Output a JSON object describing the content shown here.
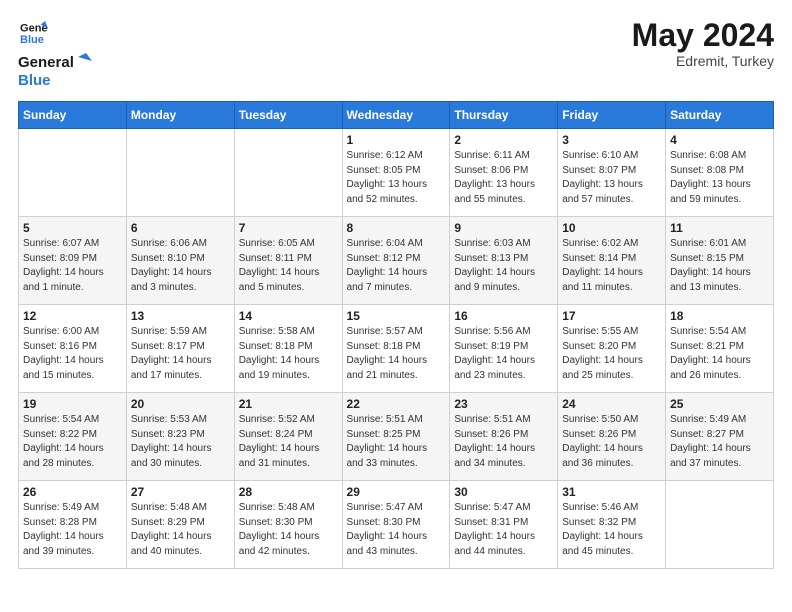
{
  "logo": {
    "line1": "General",
    "line2": "Blue"
  },
  "title": "May 2024",
  "subtitle": "Edremit, Turkey",
  "header_days": [
    "Sunday",
    "Monday",
    "Tuesday",
    "Wednesday",
    "Thursday",
    "Friday",
    "Saturday"
  ],
  "weeks": [
    [
      {
        "day": "",
        "info": ""
      },
      {
        "day": "",
        "info": ""
      },
      {
        "day": "",
        "info": ""
      },
      {
        "day": "1",
        "info": "Sunrise: 6:12 AM\nSunset: 8:05 PM\nDaylight: 13 hours\nand 52 minutes."
      },
      {
        "day": "2",
        "info": "Sunrise: 6:11 AM\nSunset: 8:06 PM\nDaylight: 13 hours\nand 55 minutes."
      },
      {
        "day": "3",
        "info": "Sunrise: 6:10 AM\nSunset: 8:07 PM\nDaylight: 13 hours\nand 57 minutes."
      },
      {
        "day": "4",
        "info": "Sunrise: 6:08 AM\nSunset: 8:08 PM\nDaylight: 13 hours\nand 59 minutes."
      }
    ],
    [
      {
        "day": "5",
        "info": "Sunrise: 6:07 AM\nSunset: 8:09 PM\nDaylight: 14 hours\nand 1 minute."
      },
      {
        "day": "6",
        "info": "Sunrise: 6:06 AM\nSunset: 8:10 PM\nDaylight: 14 hours\nand 3 minutes."
      },
      {
        "day": "7",
        "info": "Sunrise: 6:05 AM\nSunset: 8:11 PM\nDaylight: 14 hours\nand 5 minutes."
      },
      {
        "day": "8",
        "info": "Sunrise: 6:04 AM\nSunset: 8:12 PM\nDaylight: 14 hours\nand 7 minutes."
      },
      {
        "day": "9",
        "info": "Sunrise: 6:03 AM\nSunset: 8:13 PM\nDaylight: 14 hours\nand 9 minutes."
      },
      {
        "day": "10",
        "info": "Sunrise: 6:02 AM\nSunset: 8:14 PM\nDaylight: 14 hours\nand 11 minutes."
      },
      {
        "day": "11",
        "info": "Sunrise: 6:01 AM\nSunset: 8:15 PM\nDaylight: 14 hours\nand 13 minutes."
      }
    ],
    [
      {
        "day": "12",
        "info": "Sunrise: 6:00 AM\nSunset: 8:16 PM\nDaylight: 14 hours\nand 15 minutes."
      },
      {
        "day": "13",
        "info": "Sunrise: 5:59 AM\nSunset: 8:17 PM\nDaylight: 14 hours\nand 17 minutes."
      },
      {
        "day": "14",
        "info": "Sunrise: 5:58 AM\nSunset: 8:18 PM\nDaylight: 14 hours\nand 19 minutes."
      },
      {
        "day": "15",
        "info": "Sunrise: 5:57 AM\nSunset: 8:18 PM\nDaylight: 14 hours\nand 21 minutes."
      },
      {
        "day": "16",
        "info": "Sunrise: 5:56 AM\nSunset: 8:19 PM\nDaylight: 14 hours\nand 23 minutes."
      },
      {
        "day": "17",
        "info": "Sunrise: 5:55 AM\nSunset: 8:20 PM\nDaylight: 14 hours\nand 25 minutes."
      },
      {
        "day": "18",
        "info": "Sunrise: 5:54 AM\nSunset: 8:21 PM\nDaylight: 14 hours\nand 26 minutes."
      }
    ],
    [
      {
        "day": "19",
        "info": "Sunrise: 5:54 AM\nSunset: 8:22 PM\nDaylight: 14 hours\nand 28 minutes."
      },
      {
        "day": "20",
        "info": "Sunrise: 5:53 AM\nSunset: 8:23 PM\nDaylight: 14 hours\nand 30 minutes."
      },
      {
        "day": "21",
        "info": "Sunrise: 5:52 AM\nSunset: 8:24 PM\nDaylight: 14 hours\nand 31 minutes."
      },
      {
        "day": "22",
        "info": "Sunrise: 5:51 AM\nSunset: 8:25 PM\nDaylight: 14 hours\nand 33 minutes."
      },
      {
        "day": "23",
        "info": "Sunrise: 5:51 AM\nSunset: 8:26 PM\nDaylight: 14 hours\nand 34 minutes."
      },
      {
        "day": "24",
        "info": "Sunrise: 5:50 AM\nSunset: 8:26 PM\nDaylight: 14 hours\nand 36 minutes."
      },
      {
        "day": "25",
        "info": "Sunrise: 5:49 AM\nSunset: 8:27 PM\nDaylight: 14 hours\nand 37 minutes."
      }
    ],
    [
      {
        "day": "26",
        "info": "Sunrise: 5:49 AM\nSunset: 8:28 PM\nDaylight: 14 hours\nand 39 minutes."
      },
      {
        "day": "27",
        "info": "Sunrise: 5:48 AM\nSunset: 8:29 PM\nDaylight: 14 hours\nand 40 minutes."
      },
      {
        "day": "28",
        "info": "Sunrise: 5:48 AM\nSunset: 8:30 PM\nDaylight: 14 hours\nand 42 minutes."
      },
      {
        "day": "29",
        "info": "Sunrise: 5:47 AM\nSunset: 8:30 PM\nDaylight: 14 hours\nand 43 minutes."
      },
      {
        "day": "30",
        "info": "Sunrise: 5:47 AM\nSunset: 8:31 PM\nDaylight: 14 hours\nand 44 minutes."
      },
      {
        "day": "31",
        "info": "Sunrise: 5:46 AM\nSunset: 8:32 PM\nDaylight: 14 hours\nand 45 minutes."
      },
      {
        "day": "",
        "info": ""
      }
    ]
  ]
}
